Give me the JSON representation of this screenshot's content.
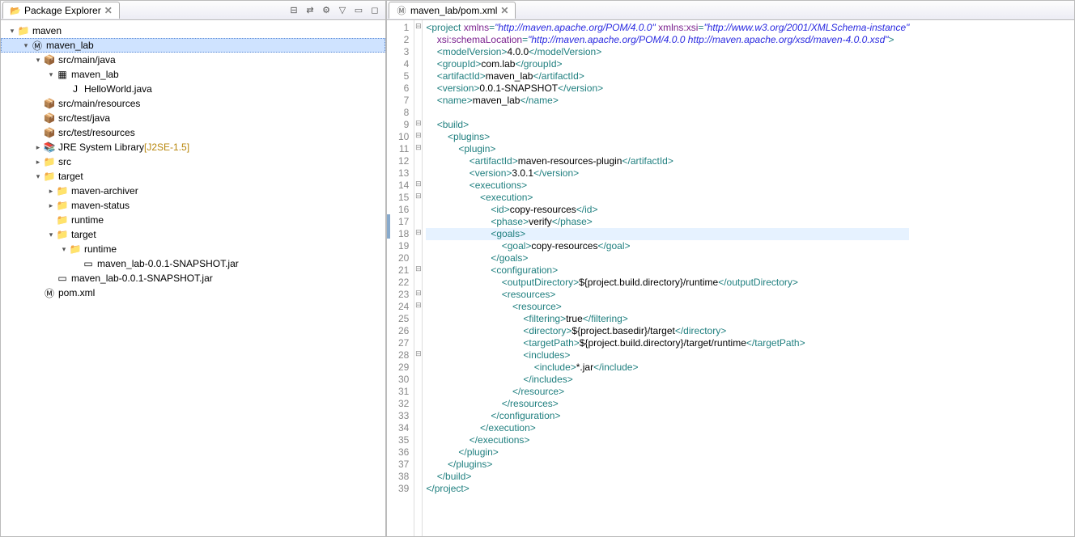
{
  "explorer": {
    "title": "Package Explorer",
    "nodes": [
      {
        "indent": 0,
        "arrow": "▾",
        "icon": "project",
        "label": "maven"
      },
      {
        "indent": 1,
        "arrow": "▾",
        "icon": "maven-project",
        "label": "maven_lab",
        "selected": true
      },
      {
        "indent": 2,
        "arrow": "▾",
        "icon": "package-folder",
        "label": "src/main/java"
      },
      {
        "indent": 3,
        "arrow": "▾",
        "icon": "package",
        "label": "maven_lab"
      },
      {
        "indent": 4,
        "arrow": "",
        "icon": "java-file",
        "label": "HelloWorld.java"
      },
      {
        "indent": 2,
        "arrow": "",
        "icon": "package-folder",
        "label": "src/main/resources"
      },
      {
        "indent": 2,
        "arrow": "",
        "icon": "package-folder",
        "label": "src/test/java"
      },
      {
        "indent": 2,
        "arrow": "",
        "icon": "package-folder",
        "label": "src/test/resources"
      },
      {
        "indent": 2,
        "arrow": "▸",
        "icon": "library",
        "label": "JRE System Library",
        "deco": "[J2SE-1.5]"
      },
      {
        "indent": 2,
        "arrow": "▸",
        "icon": "folder",
        "label": "src"
      },
      {
        "indent": 2,
        "arrow": "▾",
        "icon": "folder",
        "label": "target"
      },
      {
        "indent": 3,
        "arrow": "▸",
        "icon": "folder",
        "label": "maven-archiver"
      },
      {
        "indent": 3,
        "arrow": "▸",
        "icon": "folder",
        "label": "maven-status"
      },
      {
        "indent": 3,
        "arrow": "",
        "icon": "folder",
        "label": "runtime"
      },
      {
        "indent": 3,
        "arrow": "▾",
        "icon": "folder",
        "label": "target"
      },
      {
        "indent": 4,
        "arrow": "▾",
        "icon": "folder",
        "label": "runtime"
      },
      {
        "indent": 5,
        "arrow": "",
        "icon": "jar",
        "label": "maven_lab-0.0.1-SNAPSHOT.jar"
      },
      {
        "indent": 3,
        "arrow": "",
        "icon": "jar",
        "label": "maven_lab-0.0.1-SNAPSHOT.jar"
      },
      {
        "indent": 2,
        "arrow": "",
        "icon": "xml-file",
        "label": "pom.xml"
      }
    ]
  },
  "editor_tab": {
    "icon": "xml-file",
    "label": "maven_lab/pom.xml"
  },
  "code_lines": [
    {
      "n": 1,
      "fold": "⊟",
      "tokens": [
        [
          "tag",
          "<project"
        ],
        [
          "txt",
          " "
        ],
        [
          "attr",
          "xmlns"
        ],
        [
          "tag",
          "="
        ],
        [
          "str",
          "\"http://maven.apache.org/POM/4.0.0\""
        ],
        [
          "txt",
          " "
        ],
        [
          "attr",
          "xmlns:xsi"
        ],
        [
          "tag",
          "="
        ],
        [
          "str",
          "\"http://www.w3.org/2001/XMLSchema-instance\""
        ]
      ]
    },
    {
      "n": 2,
      "fold": "",
      "tokens": [
        [
          "txt",
          "    "
        ],
        [
          "attr",
          "xsi:schemaLocation"
        ],
        [
          "tag",
          "="
        ],
        [
          "str",
          "\"http://maven.apache.org/POM/4.0.0 http://maven.apache.org/xsd/maven-4.0.0.xsd\""
        ],
        [
          "tag",
          ">"
        ]
      ]
    },
    {
      "n": 3,
      "fold": "",
      "tokens": [
        [
          "txt",
          "    "
        ],
        [
          "tag",
          "<modelVersion>"
        ],
        [
          "txt",
          "4.0.0"
        ],
        [
          "tag",
          "</modelVersion>"
        ]
      ]
    },
    {
      "n": 4,
      "fold": "",
      "tokens": [
        [
          "txt",
          "    "
        ],
        [
          "tag",
          "<groupId>"
        ],
        [
          "txt",
          "com.lab"
        ],
        [
          "tag",
          "</groupId>"
        ]
      ]
    },
    {
      "n": 5,
      "fold": "",
      "tokens": [
        [
          "txt",
          "    "
        ],
        [
          "tag",
          "<artifactId>"
        ],
        [
          "txt",
          "maven_lab"
        ],
        [
          "tag",
          "</artifactId>"
        ]
      ]
    },
    {
      "n": 6,
      "fold": "",
      "tokens": [
        [
          "txt",
          "    "
        ],
        [
          "tag",
          "<version>"
        ],
        [
          "txt",
          "0.0.1-SNAPSHOT"
        ],
        [
          "tag",
          "</version>"
        ]
      ]
    },
    {
      "n": 7,
      "fold": "",
      "tokens": [
        [
          "txt",
          "    "
        ],
        [
          "tag",
          "<name>"
        ],
        [
          "txt",
          "maven_lab"
        ],
        [
          "tag",
          "</name>"
        ]
      ]
    },
    {
      "n": 8,
      "fold": "",
      "tokens": []
    },
    {
      "n": 9,
      "fold": "⊟",
      "tokens": [
        [
          "txt",
          "    "
        ],
        [
          "tag",
          "<build>"
        ]
      ]
    },
    {
      "n": 10,
      "fold": "⊟",
      "tokens": [
        [
          "txt",
          "        "
        ],
        [
          "tag",
          "<plugins>"
        ]
      ]
    },
    {
      "n": 11,
      "fold": "⊟",
      "tokens": [
        [
          "txt",
          "            "
        ],
        [
          "tag",
          "<plugin>"
        ]
      ]
    },
    {
      "n": 12,
      "fold": "",
      "tokens": [
        [
          "txt",
          "                "
        ],
        [
          "tag",
          "<artifactId>"
        ],
        [
          "txt",
          "maven-resources-plugin"
        ],
        [
          "tag",
          "</artifactId>"
        ]
      ]
    },
    {
      "n": 13,
      "fold": "",
      "tokens": [
        [
          "txt",
          "                "
        ],
        [
          "tag",
          "<version>"
        ],
        [
          "txt",
          "3.0.1"
        ],
        [
          "tag",
          "</version>"
        ]
      ]
    },
    {
      "n": 14,
      "fold": "⊟",
      "tokens": [
        [
          "txt",
          "                "
        ],
        [
          "tag",
          "<executions>"
        ]
      ]
    },
    {
      "n": 15,
      "fold": "⊟",
      "tokens": [
        [
          "txt",
          "                    "
        ],
        [
          "tag",
          "<execution>"
        ]
      ]
    },
    {
      "n": 16,
      "fold": "",
      "tokens": [
        [
          "txt",
          "                        "
        ],
        [
          "tag",
          "<id>"
        ],
        [
          "txt",
          "copy-resources"
        ],
        [
          "tag",
          "</id>"
        ]
      ]
    },
    {
      "n": 17,
      "fold": "",
      "cb": true,
      "tokens": [
        [
          "txt",
          "                        "
        ],
        [
          "tag",
          "<phase>"
        ],
        [
          "txt",
          "verify"
        ],
        [
          "tag",
          "</phase>"
        ]
      ]
    },
    {
      "n": 18,
      "fold": "⊟",
      "cb": true,
      "hl": true,
      "tokens": [
        [
          "txt",
          "                        "
        ],
        [
          "tag",
          "<goals>"
        ]
      ]
    },
    {
      "n": 19,
      "fold": "",
      "tokens": [
        [
          "txt",
          "                            "
        ],
        [
          "tag",
          "<goal>"
        ],
        [
          "txt",
          "copy-resources"
        ],
        [
          "tag",
          "</goal>"
        ]
      ]
    },
    {
      "n": 20,
      "fold": "",
      "tokens": [
        [
          "txt",
          "                        "
        ],
        [
          "tag",
          "</goals>"
        ]
      ]
    },
    {
      "n": 21,
      "fold": "⊟",
      "tokens": [
        [
          "txt",
          "                        "
        ],
        [
          "tag",
          "<configuration>"
        ]
      ]
    },
    {
      "n": 22,
      "fold": "",
      "tokens": [
        [
          "txt",
          "                            "
        ],
        [
          "tag",
          "<outputDirectory>"
        ],
        [
          "txt",
          "${project.build.directory}/runtime"
        ],
        [
          "tag",
          "</outputDirectory>"
        ]
      ]
    },
    {
      "n": 23,
      "fold": "⊟",
      "tokens": [
        [
          "txt",
          "                            "
        ],
        [
          "tag",
          "<resources>"
        ]
      ]
    },
    {
      "n": 24,
      "fold": "⊟",
      "tokens": [
        [
          "txt",
          "                                "
        ],
        [
          "tag",
          "<resource>"
        ]
      ]
    },
    {
      "n": 25,
      "fold": "",
      "tokens": [
        [
          "txt",
          "                                    "
        ],
        [
          "tag",
          "<filtering>"
        ],
        [
          "txt",
          "true"
        ],
        [
          "tag",
          "</filtering>"
        ]
      ]
    },
    {
      "n": 26,
      "fold": "",
      "tokens": [
        [
          "txt",
          "                                    "
        ],
        [
          "tag",
          "<directory>"
        ],
        [
          "txt",
          "${project.basedir}/target"
        ],
        [
          "tag",
          "</directory>"
        ]
      ]
    },
    {
      "n": 27,
      "fold": "",
      "tokens": [
        [
          "txt",
          "                                    "
        ],
        [
          "tag",
          "<targetPath>"
        ],
        [
          "txt",
          "${project.build.directory}/target/runtime"
        ],
        [
          "tag",
          "</targetPath>"
        ]
      ]
    },
    {
      "n": 28,
      "fold": "⊟",
      "tokens": [
        [
          "txt",
          "                                    "
        ],
        [
          "tag",
          "<includes>"
        ]
      ]
    },
    {
      "n": 29,
      "fold": "",
      "tokens": [
        [
          "txt",
          "                                        "
        ],
        [
          "tag",
          "<include>"
        ],
        [
          "txt",
          "*.jar"
        ],
        [
          "tag",
          "</include>"
        ]
      ]
    },
    {
      "n": 30,
      "fold": "",
      "tokens": [
        [
          "txt",
          "                                    "
        ],
        [
          "tag",
          "</includes>"
        ]
      ]
    },
    {
      "n": 31,
      "fold": "",
      "tokens": [
        [
          "txt",
          "                                "
        ],
        [
          "tag",
          "</resource>"
        ]
      ]
    },
    {
      "n": 32,
      "fold": "",
      "tokens": [
        [
          "txt",
          "                            "
        ],
        [
          "tag",
          "</resources>"
        ]
      ]
    },
    {
      "n": 33,
      "fold": "",
      "tokens": [
        [
          "txt",
          "                        "
        ],
        [
          "tag",
          "</configuration>"
        ]
      ]
    },
    {
      "n": 34,
      "fold": "",
      "tokens": [
        [
          "txt",
          "                    "
        ],
        [
          "tag",
          "</execution>"
        ]
      ]
    },
    {
      "n": 35,
      "fold": "",
      "tokens": [
        [
          "txt",
          "                "
        ],
        [
          "tag",
          "</executions>"
        ]
      ]
    },
    {
      "n": 36,
      "fold": "",
      "tokens": [
        [
          "txt",
          "            "
        ],
        [
          "tag",
          "</plugin>"
        ]
      ]
    },
    {
      "n": 37,
      "fold": "",
      "tokens": [
        [
          "txt",
          "        "
        ],
        [
          "tag",
          "</plugins>"
        ]
      ]
    },
    {
      "n": 38,
      "fold": "",
      "tokens": [
        [
          "txt",
          "    "
        ],
        [
          "tag",
          "</build>"
        ]
      ]
    },
    {
      "n": 39,
      "fold": "",
      "tokens": [
        [
          "tag",
          "</project>"
        ]
      ]
    }
  ],
  "icons": {
    "project": "📁",
    "maven-project": "Ⓜ",
    "package-folder": "📦",
    "package": "▦",
    "java-file": "J",
    "library": "📚",
    "folder": "📁",
    "jar": "▭",
    "xml-file": "Ⓜ"
  }
}
